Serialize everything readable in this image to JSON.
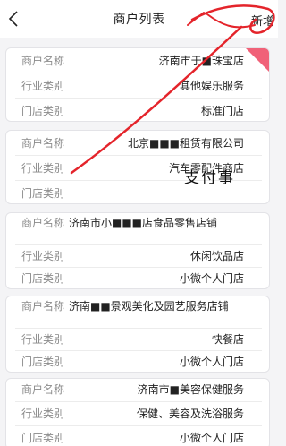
{
  "header": {
    "back_icon": "chevron-left-icon",
    "title": "商户列表",
    "add_label": "新增"
  },
  "accent_color": "#f06178",
  "handwriting": "支付事",
  "cards": [
    {
      "rows": [
        {
          "label": "商户名称",
          "value": "济南市于■珠宝店"
        },
        {
          "label": "行业类别",
          "value": "其他娱乐服务"
        },
        {
          "label": "门店类别",
          "value": "标准门店"
        }
      ],
      "selected": true
    },
    {
      "rows": [
        {
          "label": "商户名称",
          "value": "北京■■■租赁有限公司"
        },
        {
          "label": "行业类别",
          "value": "汽车零配件商店"
        },
        {
          "label": "门店类别",
          "value": ""
        }
      ]
    },
    {
      "rows": [
        {
          "label": "商户名称",
          "value": "济南市小■■■店食品零售店铺"
        },
        {
          "label": "行业类别",
          "value": "休闲饮品店"
        },
        {
          "label": "门店类别",
          "value": "小微个人门店"
        }
      ]
    },
    {
      "rows": [
        {
          "label": "商户名称",
          "value": "济南■■景观美化及园艺服务店铺"
        },
        {
          "label": "行业类别",
          "value": "快餐店"
        },
        {
          "label": "门店类别",
          "value": "小微个人门店"
        }
      ]
    },
    {
      "rows": [
        {
          "label": "商户名称",
          "value": "济南市■美容保健服务"
        },
        {
          "label": "行业类别",
          "value": "保健、美容及洗浴服务"
        },
        {
          "label": "门店类别",
          "value": "小微个人门店"
        }
      ]
    }
  ]
}
